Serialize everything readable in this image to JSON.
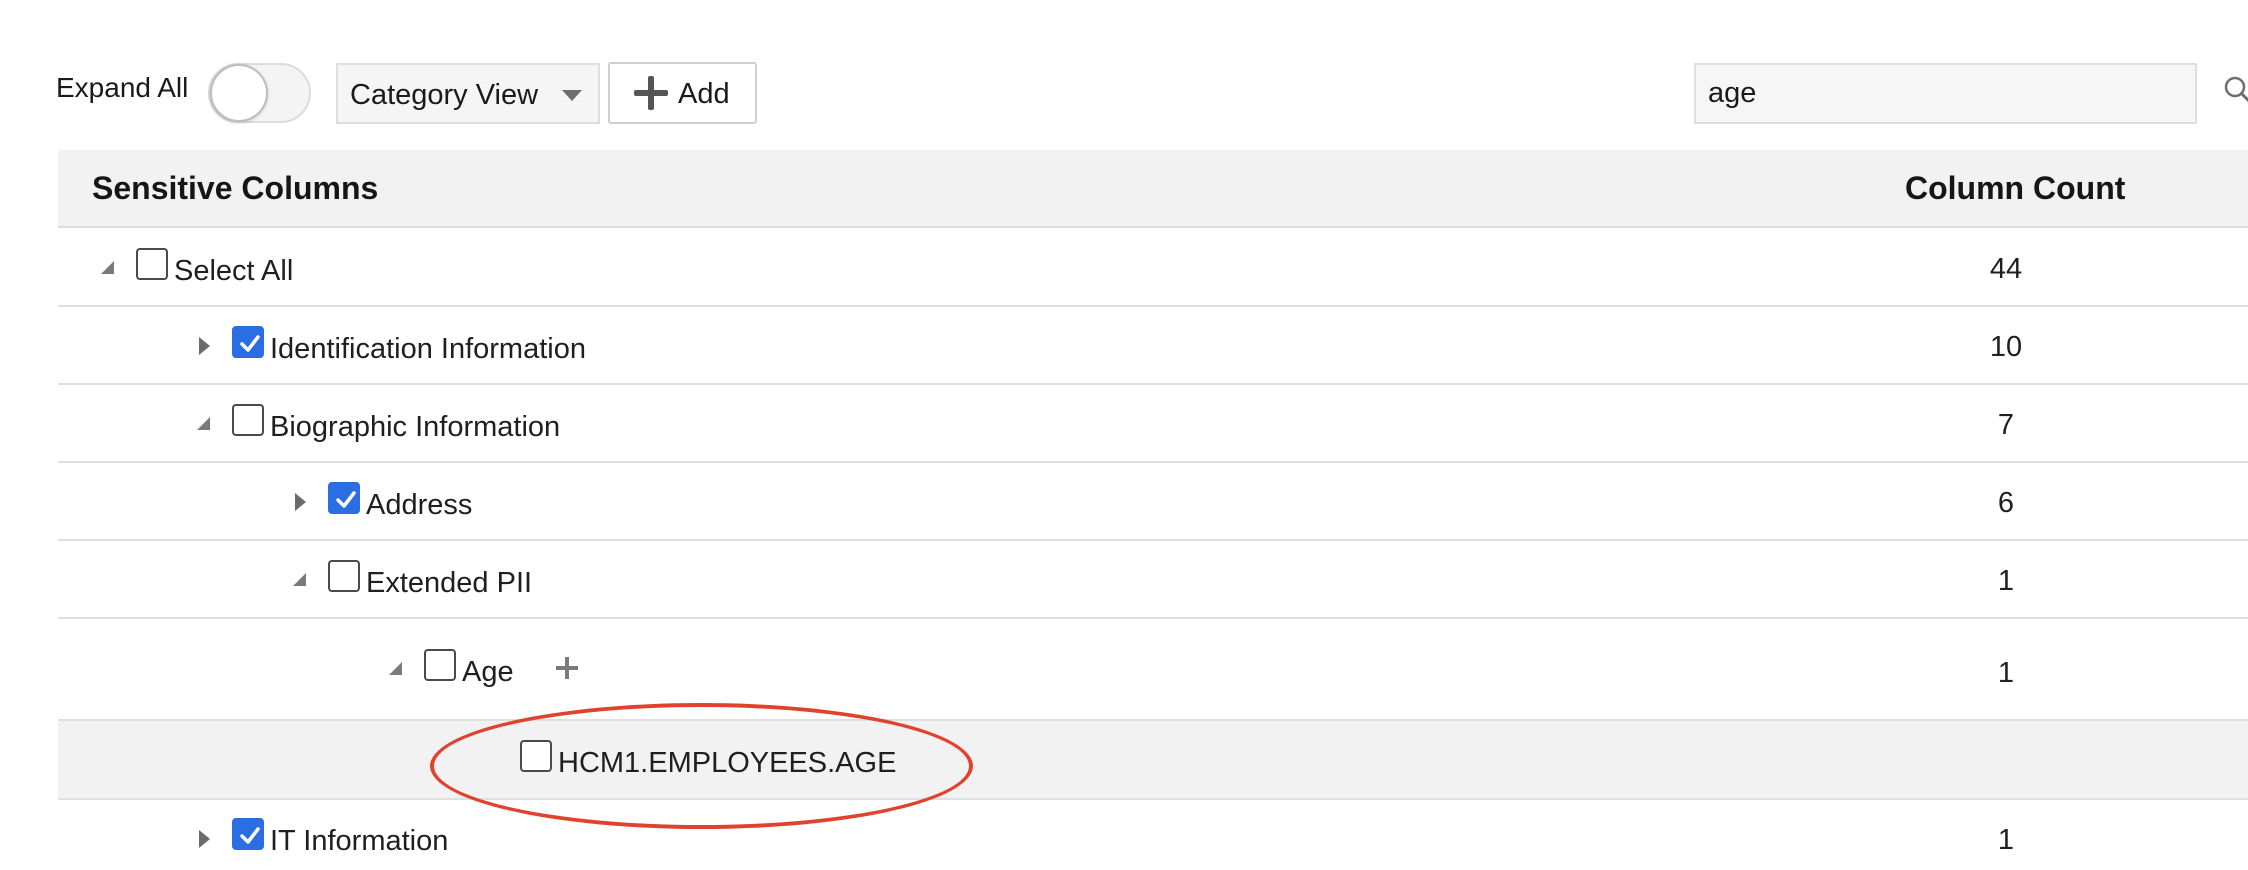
{
  "toolbar": {
    "expand_all_label": "Expand All",
    "expand_all_on": false,
    "view_select_value": "Category View",
    "add_label": "Add",
    "search_value": "age"
  },
  "grid": {
    "columns": [
      "Sensitive Columns",
      "Column Count"
    ],
    "rows": [
      {
        "label": "Select All",
        "count": "44",
        "level": 0,
        "expanded": true,
        "checked": false
      },
      {
        "label": "Identification Information",
        "count": "10",
        "level": 1,
        "expanded": false,
        "checked": true
      },
      {
        "label": "Biographic Information",
        "count": "7",
        "level": 1,
        "expanded": true,
        "checked": false
      },
      {
        "label": "Address",
        "count": "6",
        "level": 2,
        "expanded": false,
        "checked": true
      },
      {
        "label": "Extended PII",
        "count": "1",
        "level": 2,
        "expanded": true,
        "checked": false
      },
      {
        "label": "Age",
        "count": "1",
        "level": 3,
        "expanded": true,
        "checked": false
      },
      {
        "label": "HCM1.EMPLOYEES.AGE",
        "count": "",
        "level": 4,
        "checked": false,
        "selected": true
      },
      {
        "label": "IT Information",
        "count": "1",
        "level": 1,
        "expanded": false,
        "checked": true
      }
    ]
  },
  "colors": {
    "accent": "#2b6de3",
    "annotation": "#e0432d",
    "header_bg": "#f2f2f2",
    "selected_row_bg": "#f2f2f2"
  },
  "icons": {
    "search": "search-icon",
    "add": "plus-icon",
    "collapsed": "triangle-right-icon",
    "expanded": "triangle-down-right-icon",
    "checkmark": "checkmark-icon"
  }
}
